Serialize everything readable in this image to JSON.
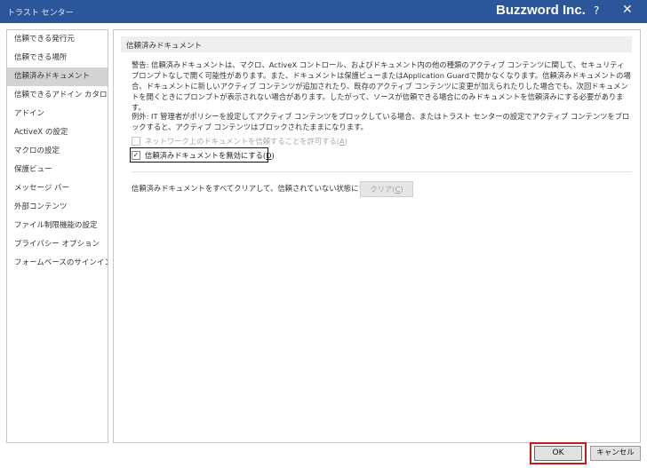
{
  "window": {
    "title": "トラスト センター",
    "brand": "Buzzword Inc.",
    "help_label": "?",
    "close_label": "✕"
  },
  "sidebar": {
    "items": [
      {
        "label": "信頼できる発行元"
      },
      {
        "label": "信頼できる場所"
      },
      {
        "label": "信頼済みドキュメント"
      },
      {
        "label": "信頼できるアドイン カタログ"
      },
      {
        "label": "アドイン"
      },
      {
        "label": "ActiveX の設定"
      },
      {
        "label": "マクロの設定"
      },
      {
        "label": "保護ビュー"
      },
      {
        "label": "メッセージ バー"
      },
      {
        "label": "外部コンテンツ"
      },
      {
        "label": "ファイル制限機能の設定"
      },
      {
        "label": "プライバシー オプション"
      },
      {
        "label": "フォームベースのサインイン"
      }
    ],
    "active_index": 2
  },
  "main": {
    "section_title": "信頼済みドキュメント",
    "warning_text": "警告: 信頼済みドキュメントは、マクロ、ActiveX コントロール、およびドキュメント内の他の種類のアクティブ コンテンツに関して、セキュリティ プロンプトなしで開く可能性があります。また、ドキュメントは保護ビューまたはApplication Guardで開かなくなります。信頼済みドキュメントの場合、ドキュメントに新しいアクティブ コンテンツが追加されたり、既存のアクティブ コンテンツに変更が加えられたりした場合でも、次回ドキュメントを開くときにプロンプトが表示されない場合があります。したがって、ソースが信頼できる場合にのみドキュメントを信頼済みにする必要があります。",
    "exception_text": "例外: IT 管理者がポリシーを設定してアクティブ コンテンツをブロックしている場合、またはトラスト センターの設定でアクティブ コンテンツをブロックすると、アクティブ コンテンツはブロックされたままになります。",
    "network_option": {
      "label": "ネットワーク上のドキュメントを信頼することを許可する",
      "access_key": "A",
      "checked": false,
      "enabled": false
    },
    "disable_option": {
      "label": "信頼済みドキュメントを無効にする",
      "access_key": "D",
      "checked": true,
      "enabled": true,
      "check_glyph": "✓"
    },
    "clear_label": "信頼済みドキュメントをすべてクリアして、信頼されていない状態にする",
    "clear_button": {
      "label": "クリア",
      "access_key": "C",
      "enabled": false
    }
  },
  "footer": {
    "ok_label": "OK",
    "cancel_label": "キャンセル"
  }
}
